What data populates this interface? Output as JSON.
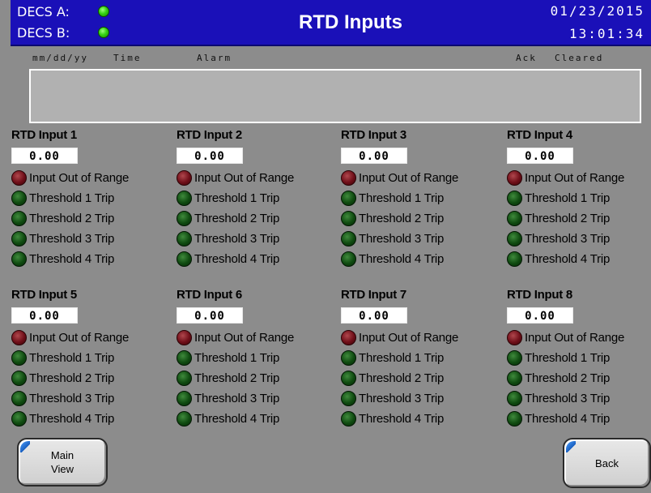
{
  "header": {
    "decs_a_label": "DECS A:",
    "decs_b_label": "DECS B:",
    "title": "RTD Inputs",
    "date": "01/23/2015",
    "time": "13:01:34"
  },
  "alarm_list": {
    "col_date": "mm/dd/yy",
    "col_time": "Time",
    "col_alarm": "Alarm",
    "col_ack": "Ack",
    "col_cleared": "Cleared"
  },
  "indicator_labels": {
    "out_of_range": "Input Out of Range",
    "t1": "Threshold 1 Trip",
    "t2": "Threshold 2 Trip",
    "t3": "Threshold 3 Trip",
    "t4": "Threshold 4 Trip"
  },
  "rtd_inputs": [
    {
      "title": "RTD Input 1",
      "value": "0.00"
    },
    {
      "title": "RTD Input 2",
      "value": "0.00"
    },
    {
      "title": "RTD Input 3",
      "value": "0.00"
    },
    {
      "title": "RTD Input 4",
      "value": "0.00"
    },
    {
      "title": "RTD Input 5",
      "value": "0.00"
    },
    {
      "title": "RTD Input 6",
      "value": "0.00"
    },
    {
      "title": "RTD Input 7",
      "value": "0.00"
    },
    {
      "title": "RTD Input 8",
      "value": "0.00"
    }
  ],
  "buttons": {
    "main_view_line1": "Main",
    "main_view_line2": "View",
    "back": "Back"
  },
  "colors": {
    "header_bg": "#1a10b8",
    "status_led_on": "#35d313",
    "alarm_led_off": "#6e0e18",
    "trip_led_off": "#0f4a10"
  },
  "icons": {
    "status": "led-green-icon",
    "out_of_range": "led-red-icon",
    "threshold": "led-green-icon"
  }
}
